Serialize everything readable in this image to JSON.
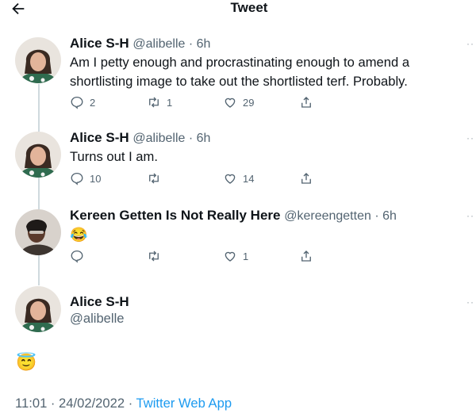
{
  "header": {
    "title": "Tweet",
    "back_icon": "arrow-left-icon"
  },
  "tweets": [
    {
      "name": "Alice S-H",
      "handle": "@alibelle",
      "sep": " · ",
      "time": "6h",
      "text": "Am I petty enough and procrastinating enough to amend a shortlisting image to take out the shortlisted terf. Probably.",
      "replies": "2",
      "retweets": "1",
      "likes": "29"
    },
    {
      "name": "Alice S-H",
      "handle": "@alibelle",
      "sep": " · ",
      "time": "6h",
      "text": "Turns out I am.",
      "replies": "10",
      "retweets": "",
      "likes": "14"
    },
    {
      "name": "Kereen Getten Is Not Really Here",
      "handle": "@kereengetten",
      "sep": " · ",
      "time": "6h",
      "text": "😂",
      "replies": "",
      "retweets": "",
      "likes": "1"
    }
  ],
  "main_tweet": {
    "name": "Alice S-H",
    "handle": "@alibelle",
    "text": "😇",
    "time": "11:01 · 24/02/2022",
    "dot": " · ",
    "source": "Twitter Web App"
  },
  "colors": {
    "accent": "#1d9bf0",
    "muted": "#536471",
    "text": "#0f1419"
  }
}
